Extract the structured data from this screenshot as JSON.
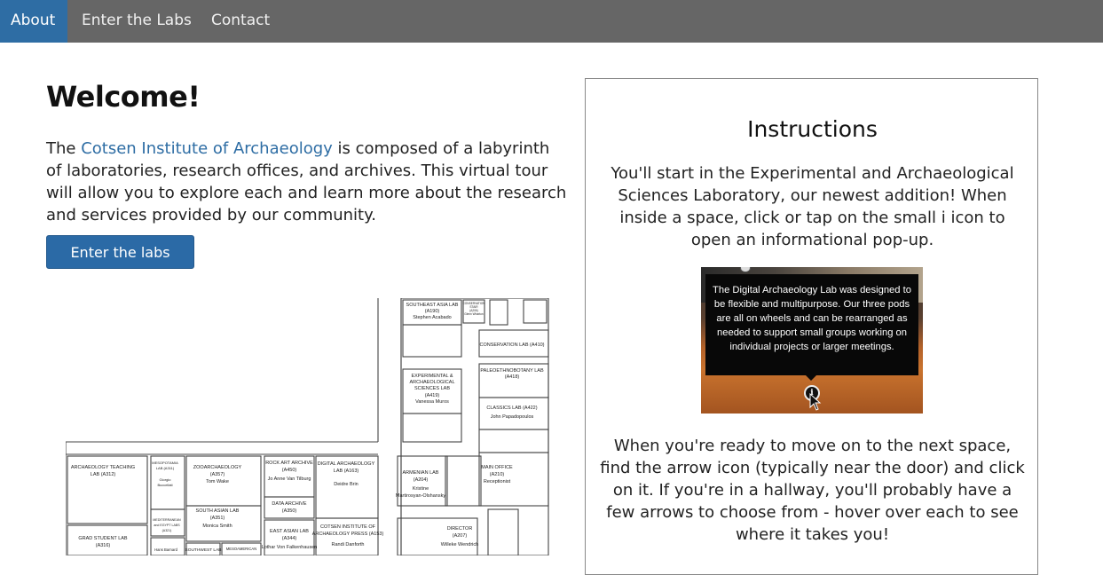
{
  "nav": {
    "items": [
      {
        "label": "About",
        "active": true
      },
      {
        "label": "Enter the Labs",
        "active": false
      },
      {
        "label": "Contact",
        "active": false
      }
    ]
  },
  "welcome": {
    "title": "Welcome!",
    "intro_before": "The ",
    "intro_link": "Cotsen Institute of Archaeology",
    "intro_after": " is composed of a labyrinth of laboratories, research offices, and archives. This virtual tour will allow you to explore each and learn more about the research and services provided by our community.",
    "enter_button": "Enter the labs"
  },
  "instructions": {
    "title": "Instructions",
    "paragraph1": "You'll start in the Experimental and Archaeological Sciences Laboratory, our newest addition! When inside a space, click or tap on the small i icon to open an informational pop-up.",
    "tooltip_text": "The Digital Archaeology Lab was designed to be flexible and multipurpose. Our three pods are all on wheels and can be rearranged as needed to support small groups working on individual projects or larger meetings.",
    "info_icon_glyph": "i",
    "paragraph2": "When you're ready to move on to the next space, find the arrow icon (typically near the door) and click on it. If you're in a hallway, you'll probably have a few arrows to choose from - hover over each to see where it takes you!"
  },
  "floorplan": {
    "rooms": [
      {
        "lines": [
          "SOUTHEAST ASIA LAB",
          "(A190)",
          "Stephen Acabado"
        ]
      },
      {
        "lines": [
          "CONSERVATION",
          "STAIR",
          "(A206)",
          "Glenn Wharton"
        ]
      },
      {
        "lines": [
          "CONSERVATION LAB (A410)"
        ]
      },
      {
        "lines": [
          "EXPERIMENTAL &",
          "ARCHAEOLOGICAL",
          "SCIENCES LAB",
          "(A419)",
          "Vanessa Muros"
        ]
      },
      {
        "lines": [
          "PALEOETHNOBOTANY LAB",
          "(A418)"
        ]
      },
      {
        "lines": [
          "CLASSICS LAB (A422)",
          "John Papadopoulos"
        ]
      },
      {
        "lines": [
          "ARCHAEOLOGY TEACHING",
          "LAB (A312)"
        ]
      },
      {
        "lines": [
          "MESOPOTAMIA",
          "LAB (A311)",
          "Giorgio",
          "Buccellati"
        ]
      },
      {
        "lines": [
          "ZOOARCHAEOLOGY",
          "(A357)",
          "Tom Wake"
        ]
      },
      {
        "lines": [
          "ROCK ART ARCHIVE",
          "(A450)",
          "Jo Anne Van Tilburg"
        ]
      },
      {
        "lines": [
          "DIGITAL ARCHAEOLOGY",
          "LAB (A163)",
          "Deidre Brin"
        ]
      },
      {
        "lines": [
          "ARMENIAN LAB",
          "(A204)",
          "Kristine",
          "Martirosyan-Olshansky"
        ]
      },
      {
        "lines": [
          "MAIN OFFICE",
          "(A210)",
          "Receptionist"
        ]
      },
      {
        "lines": [
          "SOUTH ASIAN LAB",
          "(A351)",
          "Monica Smith"
        ]
      },
      {
        "lines": [
          "DATA ARCHIVE",
          "(A350)"
        ]
      },
      {
        "lines": [
          "MEDITERRANEAN",
          "and EGYPT LABS",
          "(A321)"
        ]
      },
      {
        "lines": [
          "EAST ASIAN LAB",
          "(A344)",
          "Lothar Von Falkenhausen"
        ]
      },
      {
        "lines": [
          "COTSEN INSTITUTE OF",
          "ARCHAEOLOGY PRESS (A153)",
          "Randi Danforth"
        ]
      },
      {
        "lines": [
          "DIRECTOR",
          "(A207)",
          "Willeke Wendrich"
        ]
      },
      {
        "lines": [
          "GRAD STUDENT LAB",
          "(A316)"
        ]
      },
      {
        "lines": [
          "Hans Barnard"
        ]
      },
      {
        "lines": [
          "SOUTHWEST LAB"
        ]
      },
      {
        "lines": [
          "MESOAMERICAN"
        ]
      }
    ]
  },
  "colors": {
    "navbar": "#666666",
    "nav_active": "#2e6da4",
    "link": "#2e6da4",
    "button": "#2b6aa6"
  }
}
